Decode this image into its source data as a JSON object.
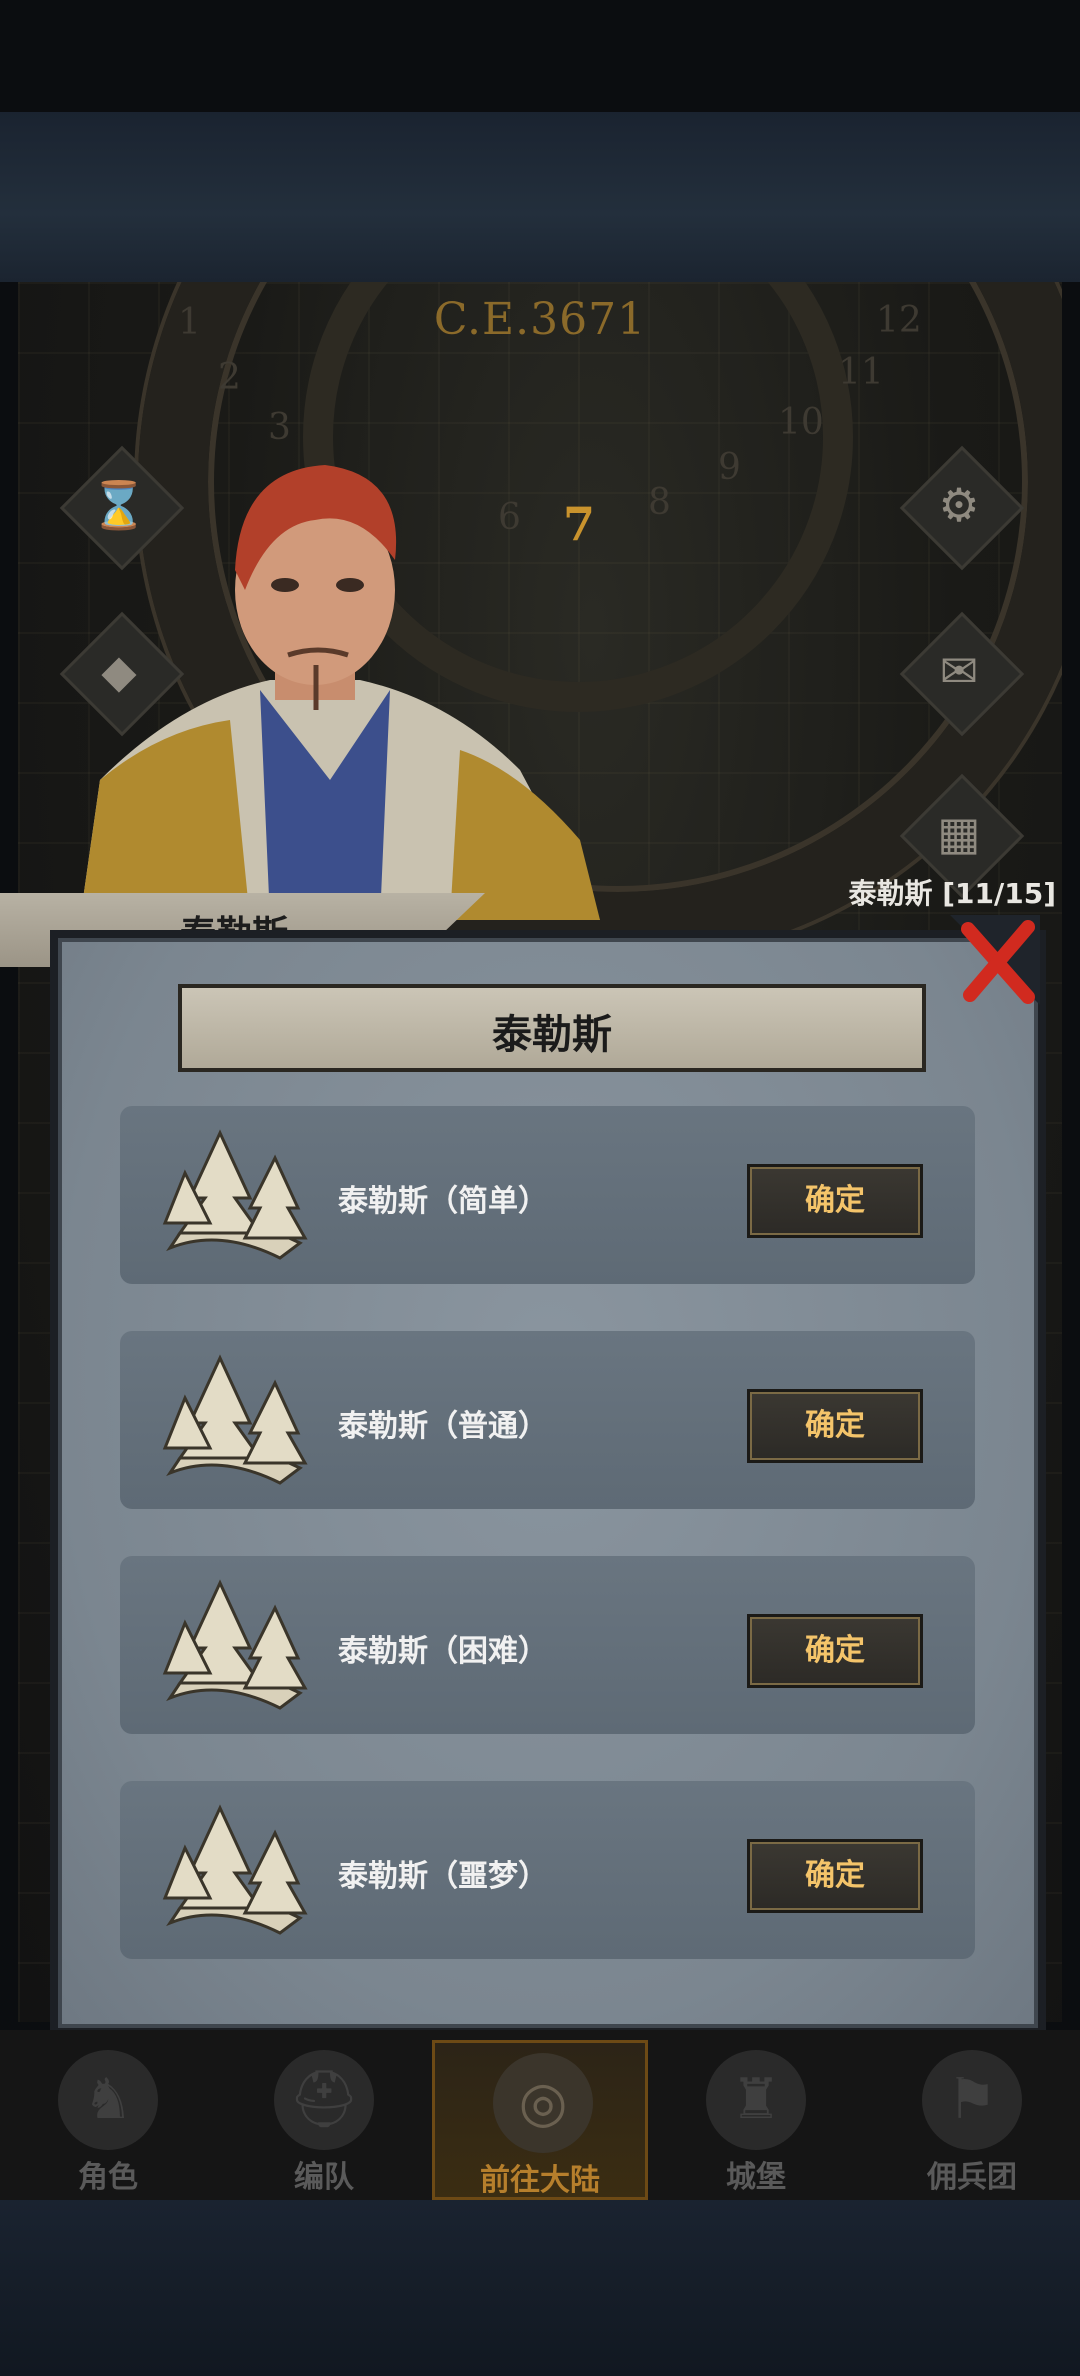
{
  "calendar": {
    "year": "C.E.3671",
    "months": [
      "1",
      "2",
      "3",
      "6",
      "7",
      "8",
      "9",
      "10",
      "11",
      "12"
    ],
    "current_month": "7"
  },
  "side_buttons": [
    {
      "icon": "hourglass-icon"
    },
    {
      "icon": "bag-icon"
    },
    {
      "icon": "gear-icon"
    },
    {
      "icon": "mail-icon"
    },
    {
      "icon": "grid-icon"
    }
  ],
  "hero": {
    "name_progress": "泰勒斯 [11/15]"
  },
  "tab": {
    "label": "泰勒斯"
  },
  "panel": {
    "title": "泰勒斯",
    "rows": [
      {
        "label": "泰勒斯（简单）",
        "button": "确定",
        "icon": "forest-icon"
      },
      {
        "label": "泰勒斯（普通）",
        "button": "确定",
        "icon": "forest-icon"
      },
      {
        "label": "泰勒斯（困难）",
        "button": "确定",
        "icon": "forest-icon"
      },
      {
        "label": "泰勒斯（噩梦）",
        "button": "确定",
        "icon": "forest-icon"
      }
    ]
  },
  "nav": [
    {
      "label": "角色",
      "icon": "knight-icon"
    },
    {
      "label": "编队",
      "icon": "helmet-icon"
    },
    {
      "label": "前往大陆",
      "icon": "globe-icon"
    },
    {
      "label": "城堡",
      "icon": "castle-icon"
    },
    {
      "label": "佣兵团",
      "icon": "banner-icon"
    }
  ],
  "colors": {
    "accent": "#f4c46a",
    "close": "#d12a1f"
  }
}
